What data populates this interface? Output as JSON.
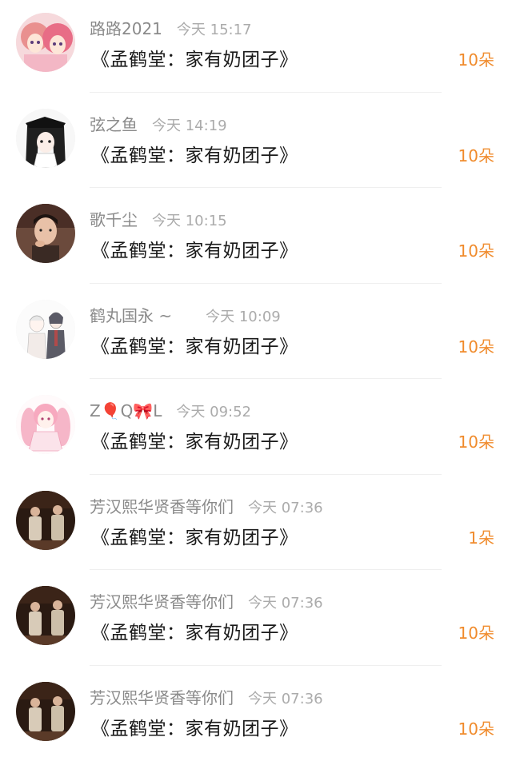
{
  "gift_list": {
    "rows": [
      {
        "name": "路路2021",
        "time": "今天 15:17",
        "gift": "《孟鹤堂：家有奶团子》",
        "count": "10朵",
        "avatar": "anime-pink-hair-twins-avatar"
      },
      {
        "name": "弦之鱼",
        "time": "今天 14:19",
        "gift": "《孟鹤堂：家有奶团子》",
        "count": "10朵",
        "avatar": "anime-dark-hair-girl-avatar"
      },
      {
        "name": "歌千尘",
        "time": "今天 10:15",
        "gift": "《孟鹤堂：家有奶团子》",
        "count": "10朵",
        "avatar": "young-man-photo-avatar"
      },
      {
        "name": "鹤丸国永 ~",
        "time": "今天 10:09",
        "gift": "《孟鹤堂：家有奶团子》",
        "count": "10朵",
        "avatar": "anime-sketch-duo-avatar"
      },
      {
        "name": "Z🎈Q🎀L",
        "time": "今天 09:52",
        "gift": "《孟鹤堂：家有奶团子》",
        "count": "10朵",
        "avatar": "anime-pink-twin-tails-avatar"
      },
      {
        "name": "芳汉熙华贤香等你们",
        "time": "今天 07:36",
        "gift": "《孟鹤堂：家有奶团子》",
        "count": "1朵",
        "avatar": "stage-performers-photo-avatar"
      },
      {
        "name": "芳汉熙华贤香等你们",
        "time": "今天 07:36",
        "gift": "《孟鹤堂：家有奶团子》",
        "count": "10朵",
        "avatar": "stage-performers-photo-avatar"
      },
      {
        "name": "芳汉熙华贤香等你们",
        "time": "今天 07:36",
        "gift": "《孟鹤堂：家有奶团子》",
        "count": "10朵",
        "avatar": "stage-performers-photo-avatar"
      }
    ]
  },
  "colors": {
    "count_accent": "#f08b2c",
    "name_gray": "#8a8a8a",
    "time_gray": "#ababab",
    "gift_text": "#1a1a1a"
  }
}
